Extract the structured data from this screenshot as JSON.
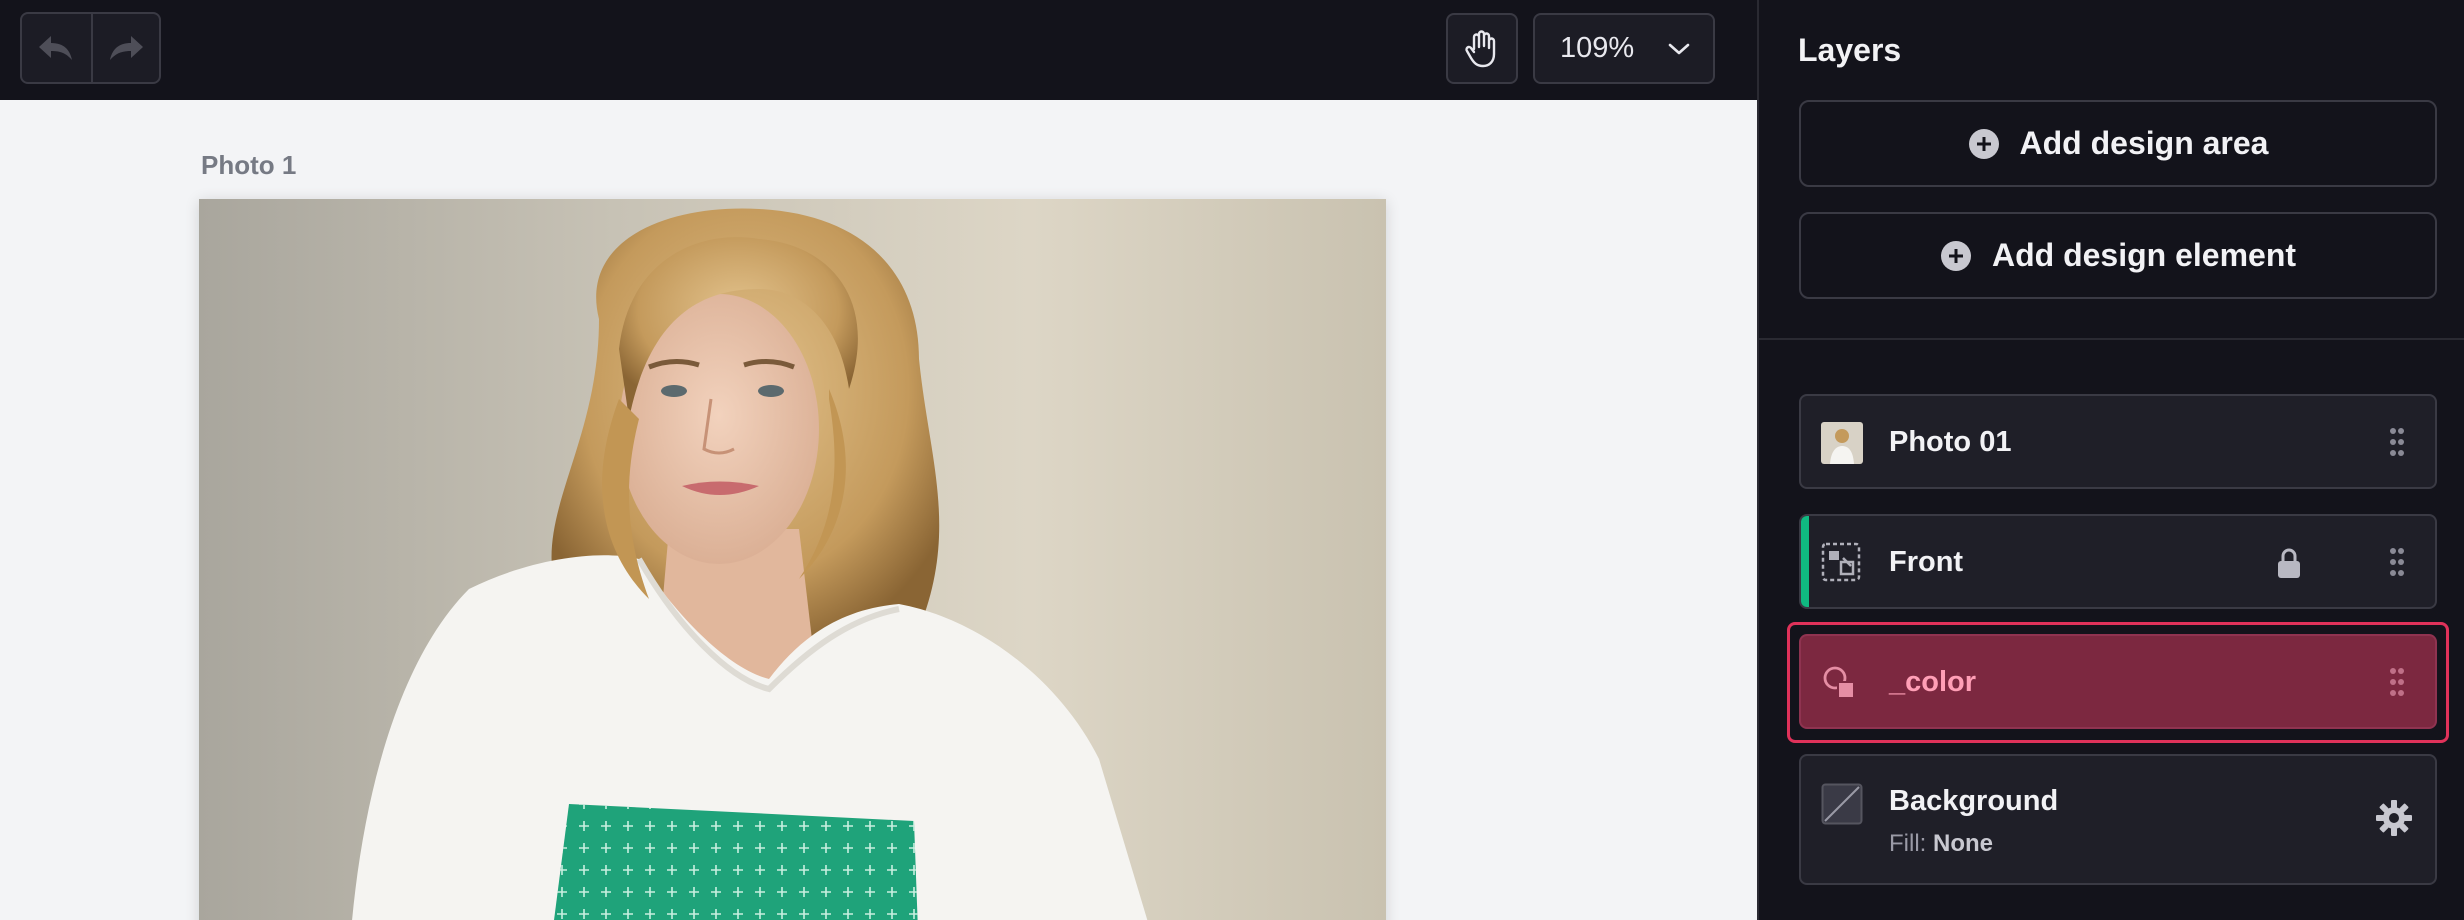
{
  "toolbar": {
    "undo_icon": "undo-icon",
    "redo_icon": "redo-icon",
    "pan_icon": "hand-icon",
    "zoom": "109%"
  },
  "canvas": {
    "photo_label": "Photo 1"
  },
  "layers_panel": {
    "title": "Layers",
    "add_design_area": "Add design area",
    "add_design_element": "Add design element",
    "layers": [
      {
        "name": "Photo 01",
        "icon": "photo-thumbnail"
      },
      {
        "name": "Front",
        "icon": "design-area-icon",
        "locked": true,
        "accent": "#10b981"
      },
      {
        "name": "_color",
        "icon": "shapes-icon",
        "selected": true
      },
      {
        "name": "Background",
        "icon": "fill-none-swatch",
        "fill_label": "Fill:",
        "fill_value": "None"
      }
    ]
  },
  "colors": {
    "toolbar_bg": "#13131b",
    "canvas_bg": "#f3f4f6",
    "selected_layer_bg": "#7c2840",
    "selected_outline": "#e0325a",
    "front_accent": "#10b981",
    "print_area": "#1fa37a"
  }
}
